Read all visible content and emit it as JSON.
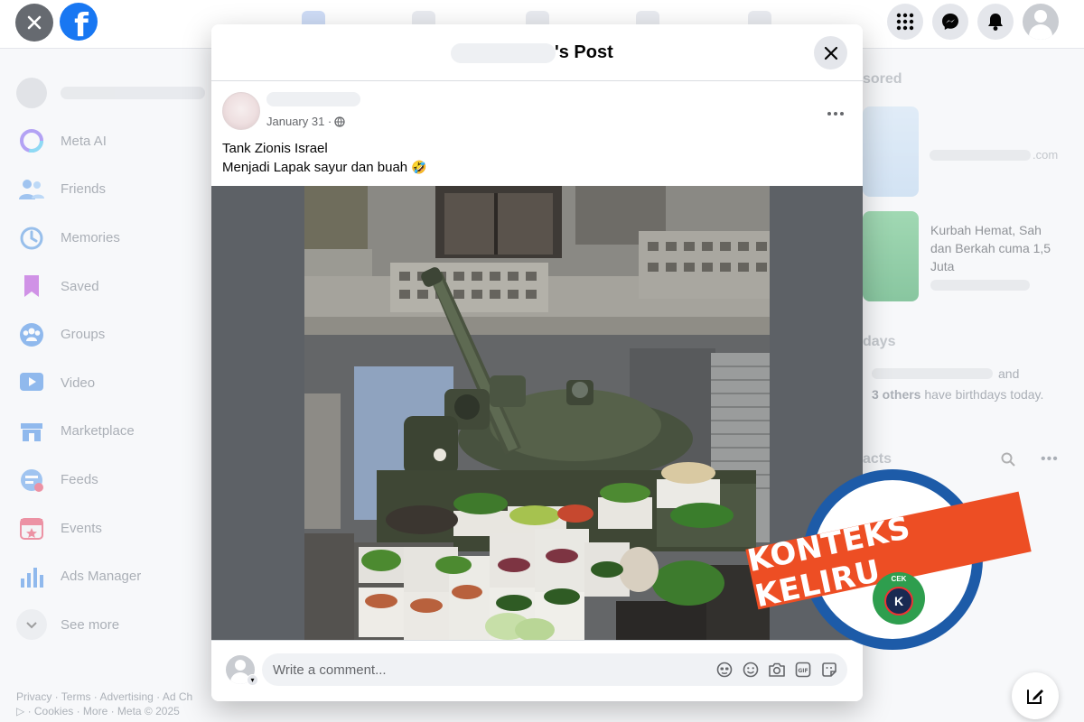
{
  "topbar": {
    "logo_letter": "f"
  },
  "sidebar": {
    "items": [
      {
        "label": "Meta AI",
        "icon": "meta-ai-icon"
      },
      {
        "label": "Friends",
        "icon": "friends-icon"
      },
      {
        "label": "Memories",
        "icon": "memories-icon"
      },
      {
        "label": "Saved",
        "icon": "saved-icon"
      },
      {
        "label": "Groups",
        "icon": "groups-icon"
      },
      {
        "label": "Video",
        "icon": "video-icon"
      },
      {
        "label": "Marketplace",
        "icon": "marketplace-icon"
      },
      {
        "label": "Feeds",
        "icon": "feeds-icon"
      },
      {
        "label": "Events",
        "icon": "events-icon"
      },
      {
        "label": "Ads Manager",
        "icon": "ads-manager-icon"
      },
      {
        "label": "See more",
        "icon": "chevron-down-icon"
      }
    ],
    "footer_line1": "Privacy · Terms · Advertising · Ad Ch",
    "footer_line2": "▷ · Cookies · More · Meta © 2025"
  },
  "rightcol": {
    "sponsored_heading": "sored",
    "ad1_domain": ".com",
    "ad2_title": "Kurbah Hemat, Sah dan Berkah cuma 1,5 Juta",
    "birthdays_heading": "days",
    "birthdays_and": "and",
    "birthdays_others": "3 others",
    "birthdays_rest": "have birthdays today.",
    "contacts_heading": "acts"
  },
  "modal": {
    "title": "'s Post",
    "post": {
      "date": "January 31 ·",
      "text_line1": "Tank Zionis Israel",
      "text_line2": "Menjadi Lapak sayur dan buah",
      "emoji": "🤣"
    },
    "comment": {
      "placeholder": "Write a comment..."
    }
  },
  "stamp": {
    "label": "KONTEKS KELIRU",
    "logo_text": "CEK"
  },
  "colors": {
    "facebook_blue": "#1877f2",
    "stamp_orange": "#ed4e24",
    "stamp_blue": "#1d5ba8",
    "stamp_green": "#2e9e4e"
  }
}
